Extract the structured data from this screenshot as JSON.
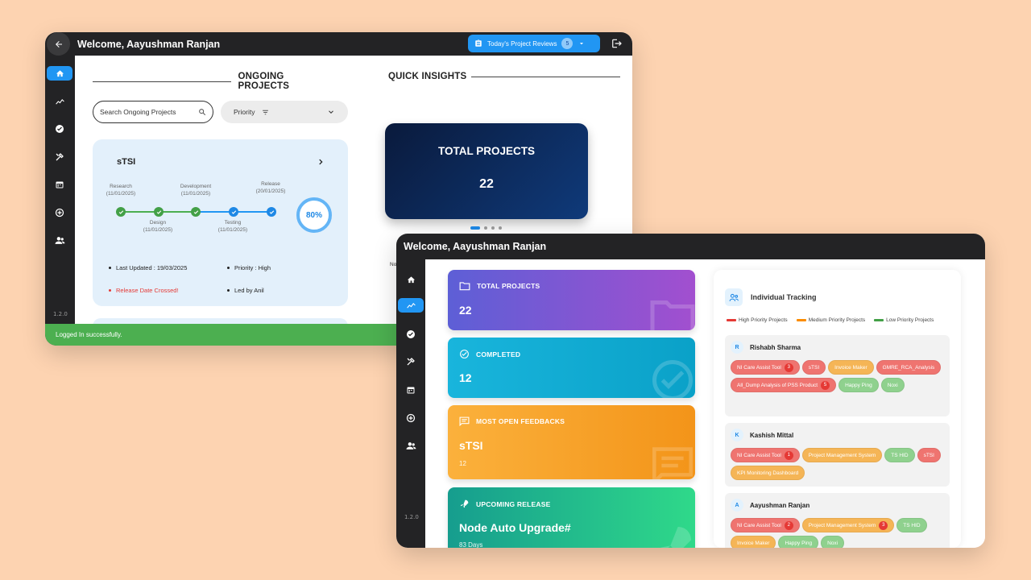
{
  "windowA": {
    "welcome": "Welcome, Aayushman Ranjan",
    "reviews_button": {
      "label": "Today's Project Reviews",
      "count": "5"
    },
    "version": "1.2.0",
    "ongoing_title": "ONGOING PROJECTS",
    "insights_title": "QUICK INSIGHTS",
    "search": {
      "placeholder": "Search Ongoing Projects"
    },
    "priority_label": "Priority",
    "project": {
      "name": "sTSI",
      "stages": [
        {
          "name": "Research",
          "date": "(11/01/2025)"
        },
        {
          "name": "Design",
          "date": "(11/01/2025)"
        },
        {
          "name": "Development",
          "date": "(11/01/2025)"
        },
        {
          "name": "Testing",
          "date": "(11/01/2025)"
        },
        {
          "name": "Release",
          "date": "(20/01/2025)"
        }
      ],
      "progress": "80%",
      "last_updated": "Last Updated : 19/03/2025",
      "priority": "Priority : High",
      "release_warning": "Release Date Crossed!",
      "led_by": "Led by Anil"
    },
    "total_card": {
      "title": "TOTAL PROJECTS",
      "value": "22"
    },
    "toast": "Logged In successfully.",
    "partial_text": "No"
  },
  "windowB": {
    "welcome": "Welcome, Aayushman Ranjan",
    "version": "1.2.0",
    "stats": [
      {
        "title": "TOTAL PROJECTS",
        "value": "22",
        "sub": ""
      },
      {
        "title": "COMPLETED",
        "value": "12",
        "sub": ""
      },
      {
        "title": "MOST OPEN FEEDBACKS",
        "value": "sTSI",
        "sub": "12"
      },
      {
        "title": "UPCOMING RELEASE",
        "value": "Node Auto Upgrade#",
        "sub": "83 Days"
      }
    ],
    "tracking": {
      "title": "Individual Tracking",
      "legend": {
        "high": "High Priority Projects",
        "medium": "Medium Priority Projects",
        "low": "Low Priority Projects"
      },
      "people": [
        {
          "initial": "R",
          "name": "Rishabh Sharma"
        },
        {
          "initial": "K",
          "name": "Kashish Mittal"
        },
        {
          "initial": "A",
          "name": "Aayushman Ranjan"
        }
      ],
      "chips": {
        "p0": [
          "NI Care Assist Tool",
          "sTSI",
          "Invoice Maker",
          "GMRE_RCA_Analysis",
          "All_Dump Analysis of PSS Product",
          "Happy Ping",
          "Noxi"
        ],
        "p0_counts": [
          "3",
          "5"
        ],
        "p1": [
          "NI Care Assist Tool",
          "Project Management System",
          "TS HID",
          "sTSI",
          "KPI Monitoring Dashboard"
        ],
        "p1_counts": [
          "1"
        ],
        "p2": [
          "NI Care Assist Tool",
          "Project Management System",
          "TS HID",
          "Invoice Maker",
          "Happy Ping",
          "Noxi"
        ],
        "p2_counts": [
          "2",
          "3"
        ]
      }
    }
  },
  "colors": {
    "accent": "#2196f3",
    "high": "#e53935",
    "medium": "#fb8c00",
    "low": "#43a047",
    "toast": "#4caf50"
  },
  "icons": [
    "arrow-left-icon",
    "clipboard-icon",
    "chevron-down-icon",
    "logout-icon",
    "home-icon",
    "analytics-icon",
    "check-circle-icon",
    "tools-icon",
    "calendar-icon",
    "add-circle-icon",
    "group-icon",
    "search-icon",
    "filter-icon",
    "chevron-right-icon",
    "folder-icon",
    "feedback-icon",
    "rocket-icon",
    "people-icon"
  ]
}
